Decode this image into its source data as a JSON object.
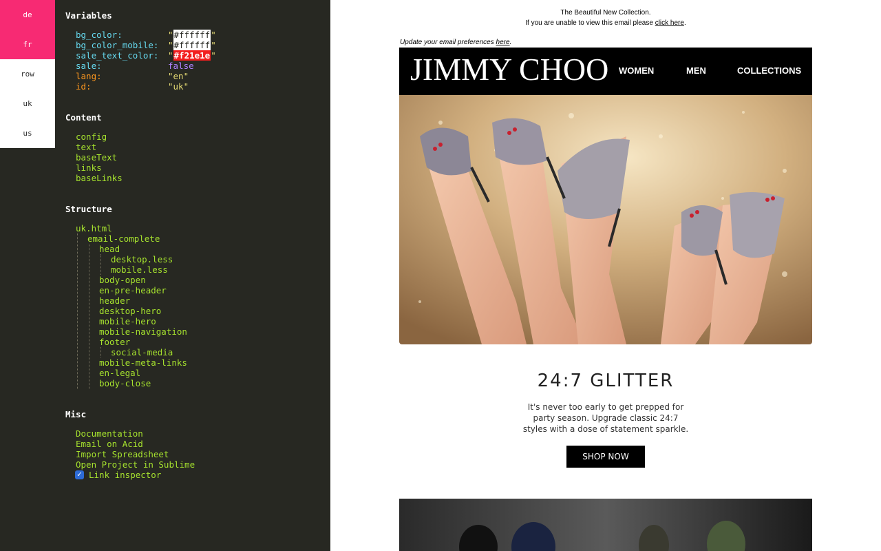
{
  "locales": [
    {
      "code": "de",
      "active": true
    },
    {
      "code": "fr",
      "active": true
    },
    {
      "code": "row",
      "active": false
    },
    {
      "code": "uk",
      "active": false
    },
    {
      "code": "us",
      "active": false
    }
  ],
  "variables": {
    "title": "Variables",
    "rows": [
      {
        "key": "bg_color:",
        "value": "\"#ffffff\""
      },
      {
        "key": "bg_color_mobile:",
        "value": "\"#ffffff\""
      },
      {
        "key": "sale_text_color:",
        "value": "\"#f21e1e\""
      },
      {
        "key": "sale:",
        "value": "false"
      },
      {
        "key": "lang:",
        "value": "\"en\""
      },
      {
        "key": "id:",
        "value": "\"uk\""
      }
    ],
    "bg_color_swatch": "#ffffff",
    "sale_color_swatch": "#f21e1e"
  },
  "content": {
    "title": "Content",
    "items": [
      "config",
      "text",
      "baseText",
      "links",
      "baseLinks"
    ]
  },
  "structure": {
    "title": "Structure",
    "items": [
      "uk.html",
      "email-complete",
      "head",
      "desktop.less",
      "mobile.less",
      "body-open",
      "en-pre-header",
      "header",
      "desktop-hero",
      "mobile-hero",
      "mobile-navigation",
      "footer",
      "social-media",
      "mobile-meta-links",
      "en-legal",
      "body-close"
    ]
  },
  "misc": {
    "title": "Misc",
    "items": [
      "Documentation",
      "Email on Acid",
      "Import Spreadsheet",
      "Open Project in Sublime"
    ],
    "link_inspector_label": "Link inspector",
    "link_inspector_checked": true
  },
  "email": {
    "preheader_line1": "The Beautiful New Collection.",
    "preheader_line2_text": "If you are unable to view this email please",
    "preheader_line2_link": "click here",
    "preferences_text": "Update your email preferences",
    "preferences_link": "here",
    "logo": "JIMMY CHOO",
    "nav": [
      "WOMEN",
      "MEN",
      "COLLECTIONS"
    ],
    "headline": "24:7 GLITTER",
    "body_line1": "It's never too early to get prepped for",
    "body_line2": "party season.  Upgrade classic 24:7",
    "body_line3": "styles with a dose of statement sparkle.",
    "cta": "SHOP NOW"
  }
}
